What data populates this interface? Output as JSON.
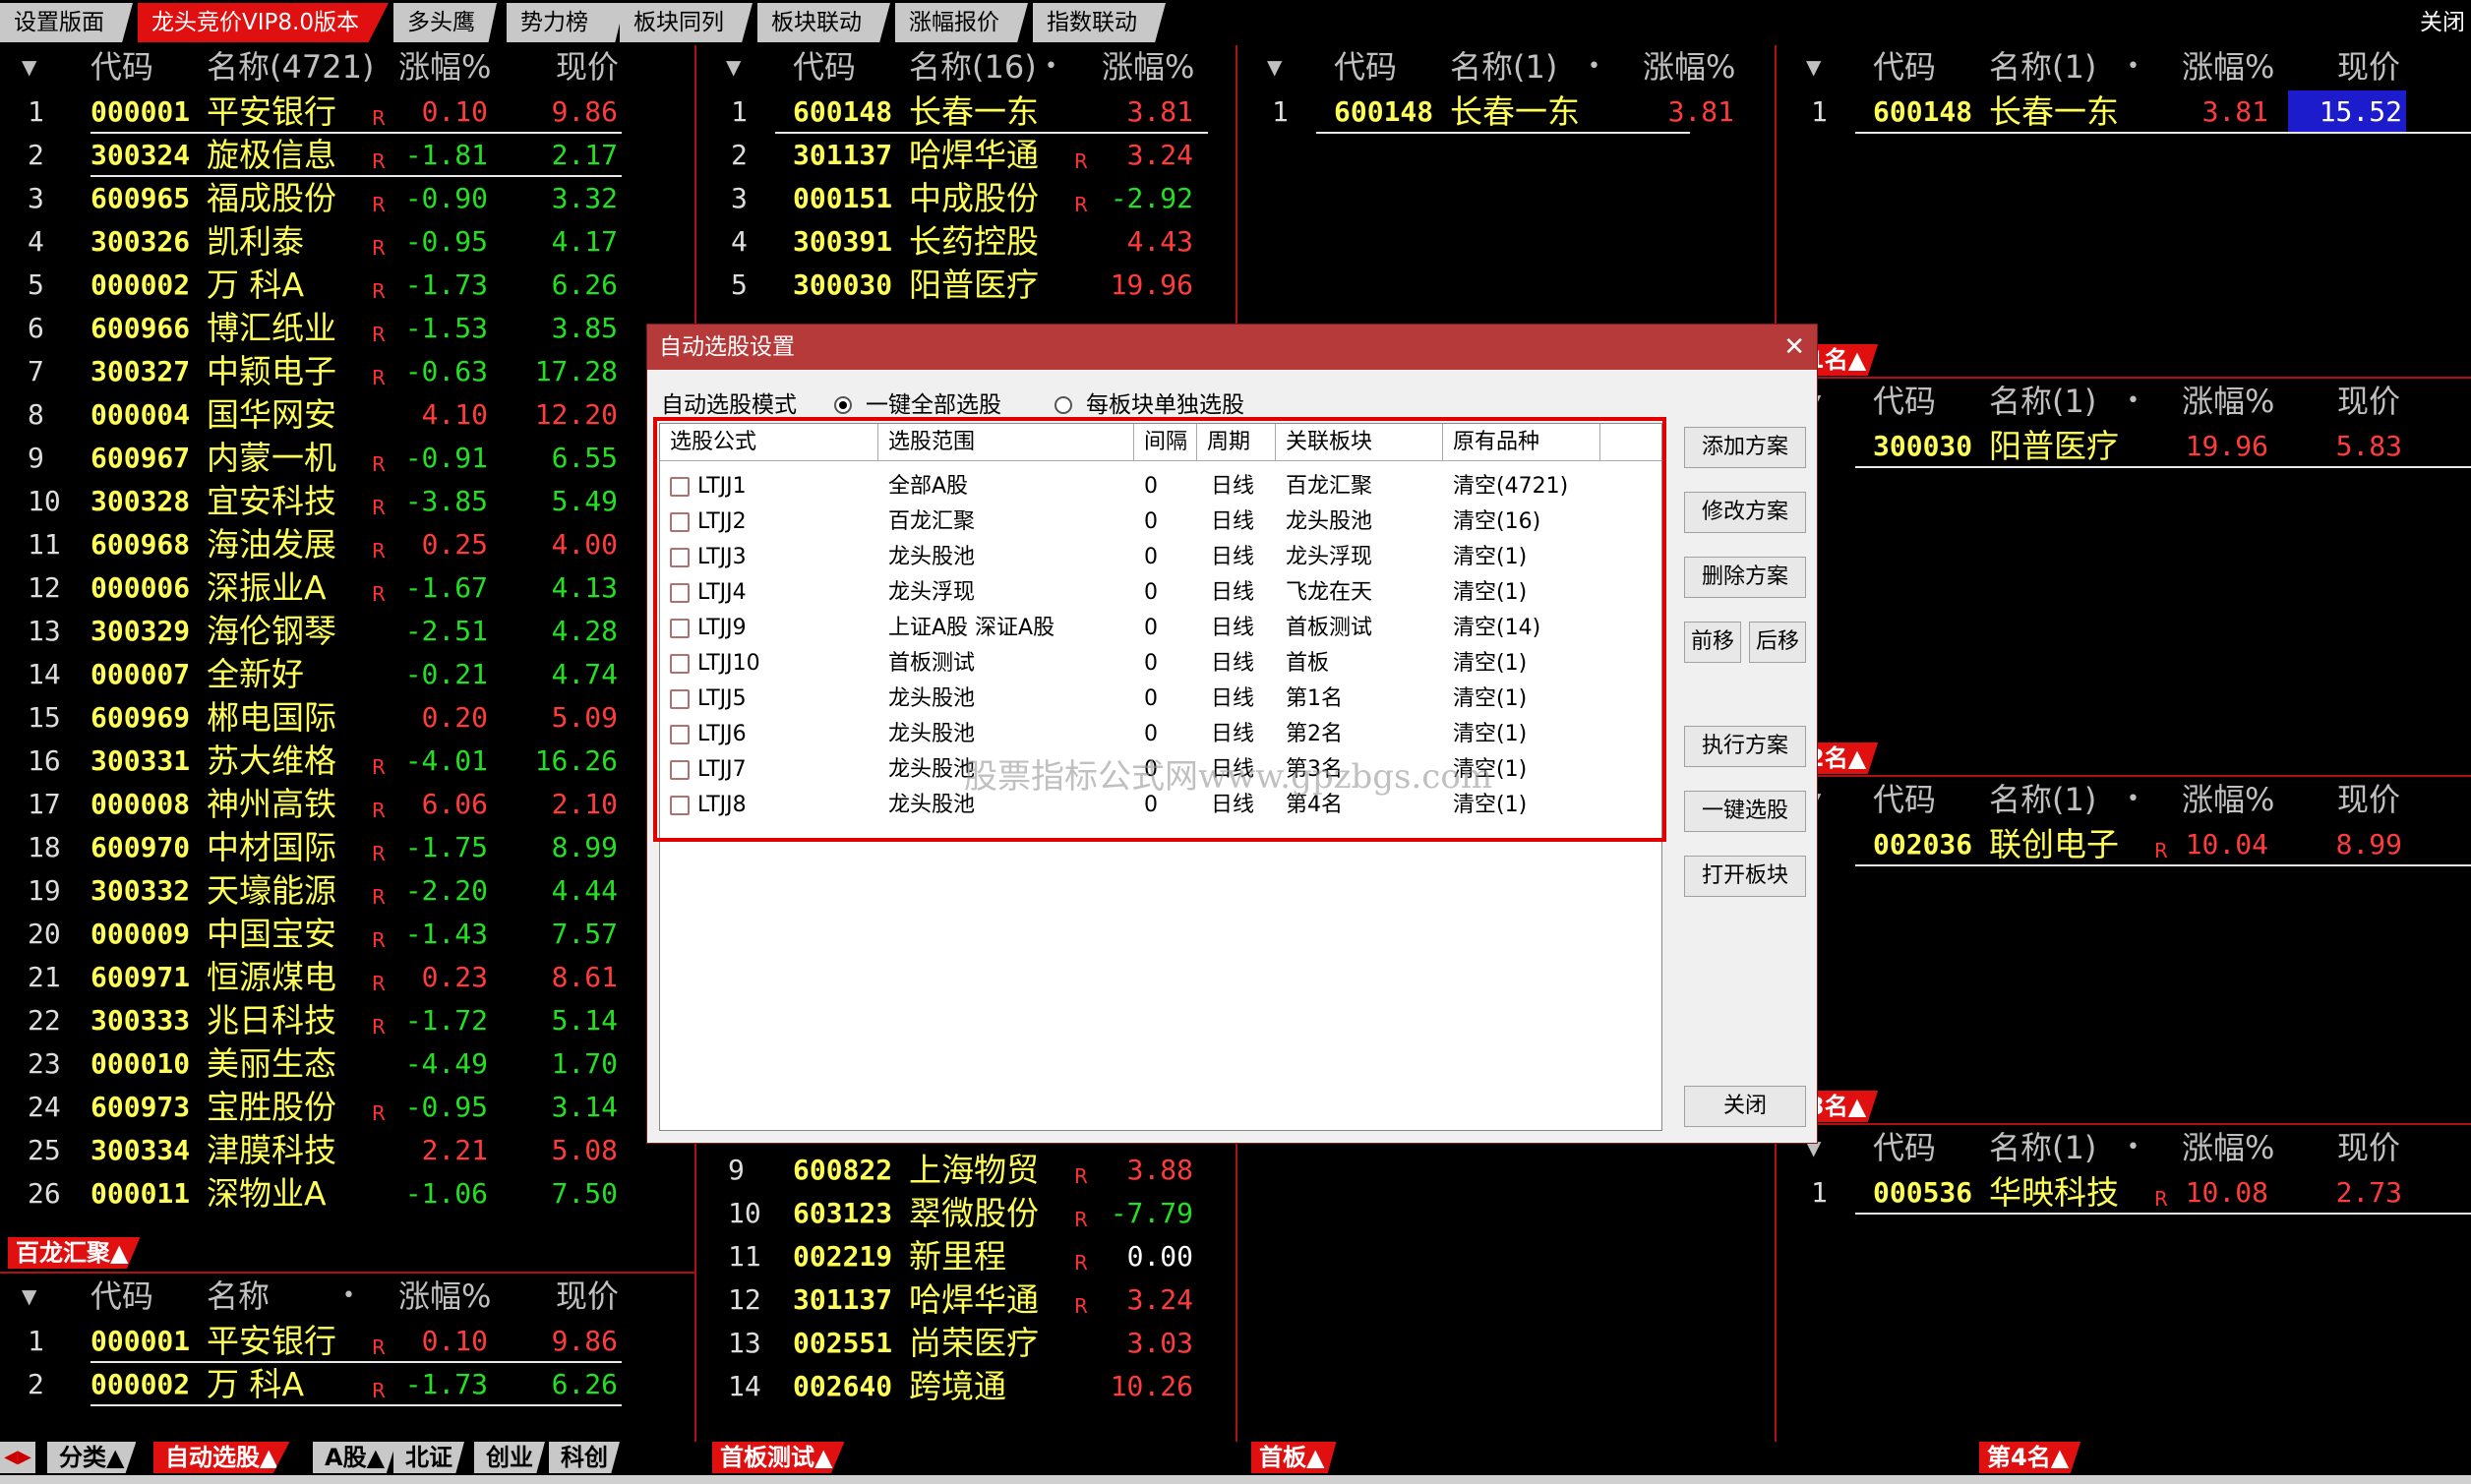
{
  "top_tabs": [
    "设置版面",
    "龙头竞价VIP8.0版本",
    "多头鹰",
    "势力榜",
    "板块同列",
    "板块联动",
    "涨幅报价",
    "指数联动"
  ],
  "top_close": "关闭",
  "col_headers": {
    "code": "代码",
    "chg": "涨幅%",
    "price": "现价",
    "name": "名称"
  },
  "panel_main": {
    "name_header": "名称(4721)",
    "rows": [
      [
        "1",
        "000001",
        "平安银行",
        "R",
        "0.10",
        "9.86",
        "up",
        "up"
      ],
      [
        "2",
        "300324",
        "旋极信息",
        "R",
        "-1.81",
        "2.17",
        "dn",
        "dn"
      ],
      [
        "3",
        "600965",
        "福成股份",
        "R",
        "-0.90",
        "3.32",
        "dn",
        "dn"
      ],
      [
        "4",
        "300326",
        "凯利泰",
        "R",
        "-0.95",
        "4.17",
        "dn",
        "dn"
      ],
      [
        "5",
        "000002",
        "万 科A",
        "R",
        "-1.73",
        "6.26",
        "dn",
        "dn"
      ],
      [
        "6",
        "600966",
        "博汇纸业",
        "R",
        "-1.53",
        "3.85",
        "dn",
        "dn"
      ],
      [
        "7",
        "300327",
        "中颖电子",
        "R",
        "-0.63",
        "17.28",
        "dn",
        "dn"
      ],
      [
        "8",
        "000004",
        "国华网安",
        "",
        "4.10",
        "12.20",
        "up",
        "up"
      ],
      [
        "9",
        "600967",
        "内蒙一机",
        "R",
        "-0.91",
        "6.55",
        "dn",
        "dn"
      ],
      [
        "10",
        "300328",
        "宜安科技",
        "R",
        "-3.85",
        "5.49",
        "dn",
        "dn"
      ],
      [
        "11",
        "600968",
        "海油发展",
        "R",
        "0.25",
        "4.00",
        "up",
        "up"
      ],
      [
        "12",
        "000006",
        "深振业A",
        "R",
        "-1.67",
        "4.13",
        "dn",
        "dn"
      ],
      [
        "13",
        "300329",
        "海伦钢琴",
        "",
        "-2.51",
        "4.28",
        "dn",
        "dn"
      ],
      [
        "14",
        "000007",
        "全新好",
        "",
        "-0.21",
        "4.74",
        "dn",
        "dn"
      ],
      [
        "15",
        "600969",
        "郴电国际",
        "",
        "0.20",
        "5.09",
        "up",
        "up"
      ],
      [
        "16",
        "300331",
        "苏大维格",
        "R",
        "-4.01",
        "16.26",
        "dn",
        "dn"
      ],
      [
        "17",
        "000008",
        "神州高铁",
        "R",
        "6.06",
        "2.10",
        "up",
        "up"
      ],
      [
        "18",
        "600970",
        "中材国际",
        "R",
        "-1.75",
        "8.99",
        "dn",
        "dn"
      ],
      [
        "19",
        "300332",
        "天壕能源",
        "R",
        "-2.20",
        "4.44",
        "dn",
        "dn"
      ],
      [
        "20",
        "000009",
        "中国宝安",
        "R",
        "-1.43",
        "7.57",
        "dn",
        "dn"
      ],
      [
        "21",
        "600971",
        "恒源煤电",
        "R",
        "0.23",
        "8.61",
        "up",
        "up"
      ],
      [
        "22",
        "300333",
        "兆日科技",
        "R",
        "-1.72",
        "5.14",
        "dn",
        "dn"
      ],
      [
        "23",
        "000010",
        "美丽生态",
        "",
        "-4.49",
        "1.70",
        "dn",
        "dn"
      ],
      [
        "24",
        "600973",
        "宝胜股份",
        "R",
        "-0.95",
        "3.14",
        "dn",
        "dn"
      ],
      [
        "25",
        "300334",
        "津膜科技",
        "",
        "2.21",
        "5.08",
        "up",
        "up"
      ],
      [
        "26",
        "000011",
        "深物业A",
        "",
        "-1.06",
        "7.50",
        "dn",
        "dn"
      ]
    ]
  },
  "panel_bl": {
    "tag": "百龙汇聚▲",
    "rows": [
      [
        "1",
        "000001",
        "平安银行",
        "R",
        "0.10",
        "9.86",
        "up",
        "up"
      ],
      [
        "2",
        "000002",
        "万 科A",
        "R",
        "-1.73",
        "6.26",
        "dn",
        "dn"
      ]
    ]
  },
  "panel_mid": {
    "name_header": "名称(16)",
    "rows_top": [
      [
        "1",
        "600148",
        "长春一东",
        "",
        "3.81",
        "",
        "up",
        ""
      ],
      [
        "2",
        "301137",
        "哈焊华通",
        "R",
        "3.24",
        "",
        "up",
        ""
      ],
      [
        "3",
        "000151",
        "中成股份",
        "R",
        "-2.92",
        "",
        "dn",
        ""
      ],
      [
        "4",
        "300391",
        "长药控股",
        "",
        "4.43",
        "",
        "up",
        ""
      ],
      [
        "5",
        "300030",
        "阳普医疗",
        "",
        "19.96",
        "",
        "up",
        ""
      ]
    ],
    "rows_bottom": [
      [
        "9",
        "600822",
        "上海物贸",
        "R",
        "3.88",
        "",
        "up",
        ""
      ],
      [
        "10",
        "603123",
        "翠微股份",
        "R",
        "-7.79",
        "",
        "dn",
        ""
      ],
      [
        "11",
        "002219",
        "新里程",
        "R",
        "0.00",
        "",
        "flat",
        ""
      ],
      [
        "12",
        "301137",
        "哈焊华通",
        "R",
        "3.24",
        "",
        "up",
        ""
      ],
      [
        "13",
        "002551",
        "尚荣医疗",
        "",
        "3.03",
        "",
        "up",
        ""
      ],
      [
        "14",
        "002640",
        "跨境通",
        "",
        "10.26",
        "",
        "up",
        ""
      ]
    ],
    "tag": "首板测试▲"
  },
  "panel_c3": {
    "name_header": "名称(1)",
    "rows": [
      [
        "1",
        "600148",
        "长春一东",
        "",
        "3.81",
        "",
        "up",
        ""
      ]
    ],
    "tag": "首板▲"
  },
  "panel_r1": {
    "name_header": "名称(1)",
    "rows": [
      [
        "1",
        "600148",
        "长春一东",
        "",
        "3.81",
        "15.52",
        "up",
        "up"
      ]
    ],
    "tag": "第1名▲"
  },
  "panel_r2": {
    "name_header": "名称(1)",
    "rows": [
      [
        "",
        "300030",
        "阳普医疗",
        "",
        "19.96",
        "5.83",
        "up",
        "up"
      ]
    ],
    "tag": "第2名▲"
  },
  "panel_r3": {
    "name_header": "名称(1)",
    "rows": [
      [
        "",
        "002036",
        "联创电子",
        "R",
        "10.04",
        "8.99",
        "up",
        "up"
      ]
    ],
    "tag": "第3名▲"
  },
  "panel_r4": {
    "name_header": "名称(1)",
    "rows": [
      [
        "1",
        "000536",
        "华映科技",
        "R",
        "10.08",
        "2.73",
        "up",
        "up"
      ]
    ],
    "tag": "第4名▲"
  },
  "bottom_tabs": [
    "分类▲",
    "自动选股▲",
    "A股▲",
    "北证",
    "创业",
    "科创"
  ],
  "dialog": {
    "title": "自动选股设置",
    "mode_label": "自动选股模式",
    "radio1": "一键全部选股",
    "radio2": "每板块单独选股",
    "columns": [
      "选股公式",
      "选股范围",
      "间隔",
      "周期",
      "关联板块",
      "原有品种"
    ],
    "rows": [
      [
        "LTJJ1",
        "全部A股",
        "0",
        "日线",
        "百龙汇聚",
        "清空(4721)"
      ],
      [
        "LTJJ2",
        "百龙汇聚",
        "0",
        "日线",
        "龙头股池",
        "清空(16)"
      ],
      [
        "LTJJ3",
        "龙头股池",
        "0",
        "日线",
        "龙头浮现",
        "清空(1)"
      ],
      [
        "LTJJ4",
        "龙头浮现",
        "0",
        "日线",
        "飞龙在天",
        "清空(1)"
      ],
      [
        "LTJJ9",
        "上证A股 深证A股",
        "0",
        "日线",
        "首板测试",
        "清空(14)"
      ],
      [
        "LTJJ10",
        "首板测试",
        "0",
        "日线",
        "首板",
        "清空(1)"
      ],
      [
        "LTJJ5",
        "龙头股池",
        "0",
        "日线",
        "第1名",
        "清空(1)"
      ],
      [
        "LTJJ6",
        "龙头股池",
        "0",
        "日线",
        "第2名",
        "清空(1)"
      ],
      [
        "LTJJ7",
        "龙头股池",
        "0",
        "日线",
        "第3名",
        "清空(1)"
      ],
      [
        "LTJJ8",
        "龙头股池",
        "0",
        "日线",
        "第4名",
        "清空(1)"
      ]
    ],
    "buttons": {
      "add": "添加方案",
      "edit": "修改方案",
      "del": "删除方案",
      "prev": "前移",
      "next": "后移",
      "run": "执行方案",
      "one": "一键选股",
      "open": "打开板块",
      "close": "关闭"
    },
    "watermark": "股票指标公式网www.gpzbgs.com"
  }
}
